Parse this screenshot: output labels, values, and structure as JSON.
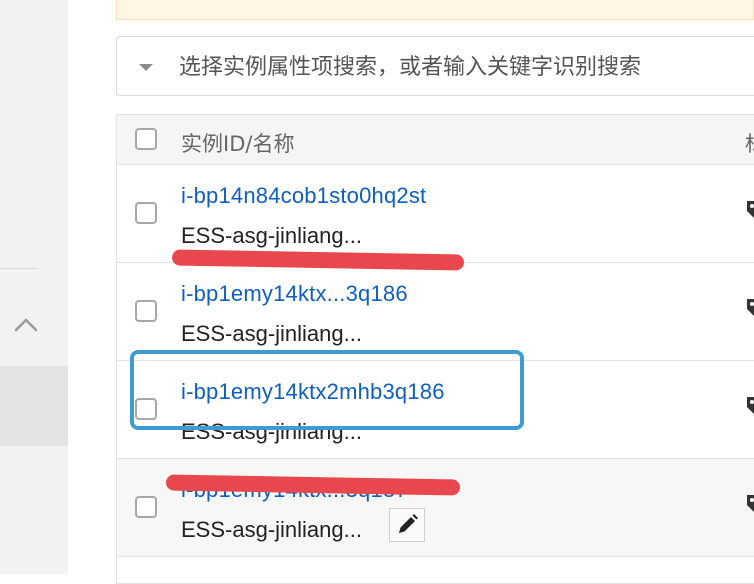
{
  "search": {
    "placeholder": "选择实例属性项搜索，或者输入关键字识别搜索"
  },
  "table": {
    "header": {
      "id_name": "实例ID/名称",
      "next_column_partial": "标"
    },
    "rows": [
      {
        "id": "i-bp14n84cob1sto0hq2st",
        "name": "ESS-asg-jinliang...",
        "id_redacted": false
      },
      {
        "id": "i-bp1emy14ktx...3q186",
        "name": "ESS-asg-jinliang...",
        "id_redacted": true
      },
      {
        "id": "i-bp1emy14ktx2mhb3q186",
        "name": "ESS-asg-jinliang...",
        "id_redacted": false,
        "highlighted": true
      },
      {
        "id": "i-bp1emy14ktx...3q187",
        "name": "ESS-asg-jinliang...",
        "id_redacted": true,
        "editable": true
      }
    ]
  },
  "icons": {
    "sidebar_collapse": "chevron-up-icon",
    "search_dropdown": "caret-down-icon",
    "tag": "tag-icon",
    "edit": "pencil-icon"
  },
  "colors": {
    "link": "#0f5fbf",
    "redaction": "#e8474d",
    "highlight": "#3e9cd2",
    "notice": "#fff6e6"
  }
}
